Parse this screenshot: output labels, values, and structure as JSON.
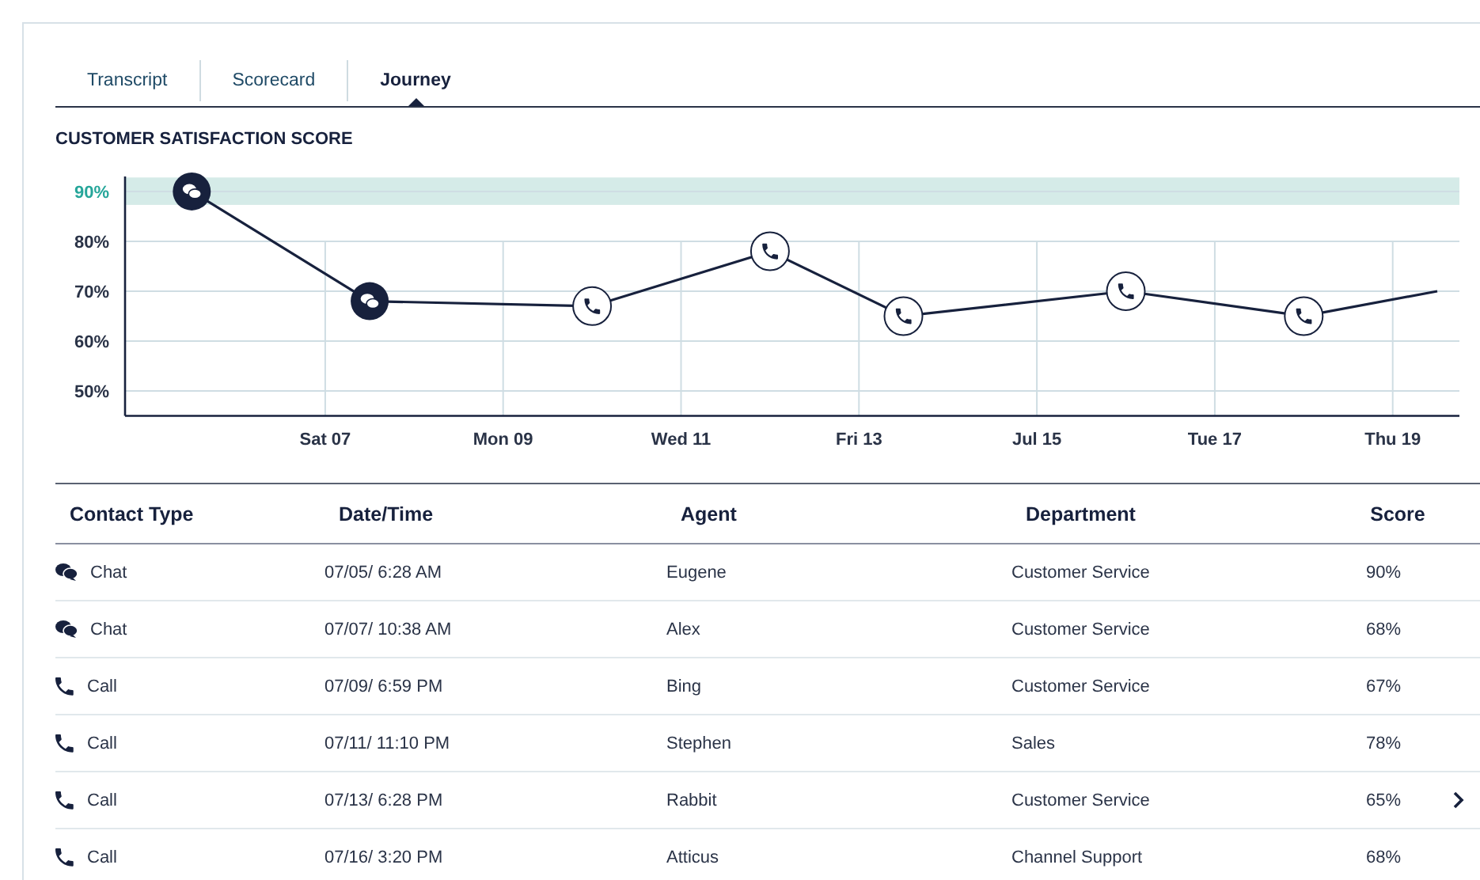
{
  "tabs": [
    {
      "label": "Transcript",
      "selected": false
    },
    {
      "label": "Scorecard",
      "selected": false
    },
    {
      "label": "Journey",
      "selected": true
    }
  ],
  "chart": {
    "title": "CUSTOMER SATISFACTION SCORE",
    "chart_data": {
      "type": "line",
      "categories": [
        null,
        null,
        null,
        null,
        "Sat 07",
        null,
        null,
        null,
        "Mon 09",
        null,
        null,
        null,
        "Wed 11",
        null,
        null,
        null,
        "Fri 13",
        null,
        null,
        null,
        "Jul 15",
        null,
        null,
        null,
        "Tue 17",
        null,
        null,
        null,
        "Thu 19",
        null
      ],
      "grid": true,
      "bands": [
        {
          "axis": "y",
          "from": 87.3,
          "to": 92.8,
          "color": "#d5ebe8"
        }
      ],
      "series": [
        {
          "color": "#17213d",
          "marker": "circle",
          "values": [
            null,
            90,
            null,
            null,
            null,
            68,
            null,
            null,
            null,
            null,
            67,
            null,
            null,
            null,
            78,
            null,
            null,
            65,
            null,
            null,
            null,
            null,
            70,
            null,
            null,
            null,
            65,
            null,
            null,
            70
          ]
        }
      ],
      "ylim": [
        45,
        93
      ],
      "yticks": [
        {
          "value": 50,
          "label": "50%"
        },
        {
          "value": 60,
          "label": "60%"
        },
        {
          "value": 70,
          "label": "70%"
        },
        {
          "value": 80,
          "label": "80%"
        },
        {
          "value": 90,
          "label": "90%"
        }
      ]
    },
    "points": [
      {
        "kind": "chat"
      },
      {
        "kind": "chat"
      },
      {
        "kind": "call"
      },
      {
        "kind": "call"
      },
      {
        "kind": "call"
      },
      {
        "kind": "call"
      },
      {
        "kind": "call"
      }
    ]
  },
  "table": {
    "columns": [
      "Contact Type",
      "Date/Time",
      "Agent",
      "Department",
      "Score"
    ],
    "rows": [
      {
        "kind": "chat",
        "cells": [
          "Chat",
          "07/05/ 6:28 AM",
          "Eugene",
          "Customer Service",
          "90%"
        ],
        "hovered": false
      },
      {
        "kind": "chat",
        "cells": [
          "Chat",
          "07/07/ 10:38 AM",
          "Alex",
          "Customer Service",
          "68%"
        ],
        "hovered": false
      },
      {
        "kind": "call",
        "cells": [
          "Call",
          "07/09/ 6:59 PM",
          "Bing",
          "Customer Service",
          "67%"
        ],
        "hovered": false
      },
      {
        "kind": "call",
        "cells": [
          "Call",
          "07/11/ 11:10 PM",
          "Stephen",
          "Sales",
          "78%"
        ],
        "hovered": false
      },
      {
        "kind": "call",
        "cells": [
          "Call",
          "07/13/ 6:28 PM",
          "Rabbit",
          "Customer Service",
          "65%"
        ],
        "hovered": true
      },
      {
        "kind": "call",
        "cells": [
          "Call",
          "07/16/ 3:20 PM",
          "Atticus",
          "Channel Support",
          "68%"
        ],
        "hovered": false
      }
    ]
  }
}
